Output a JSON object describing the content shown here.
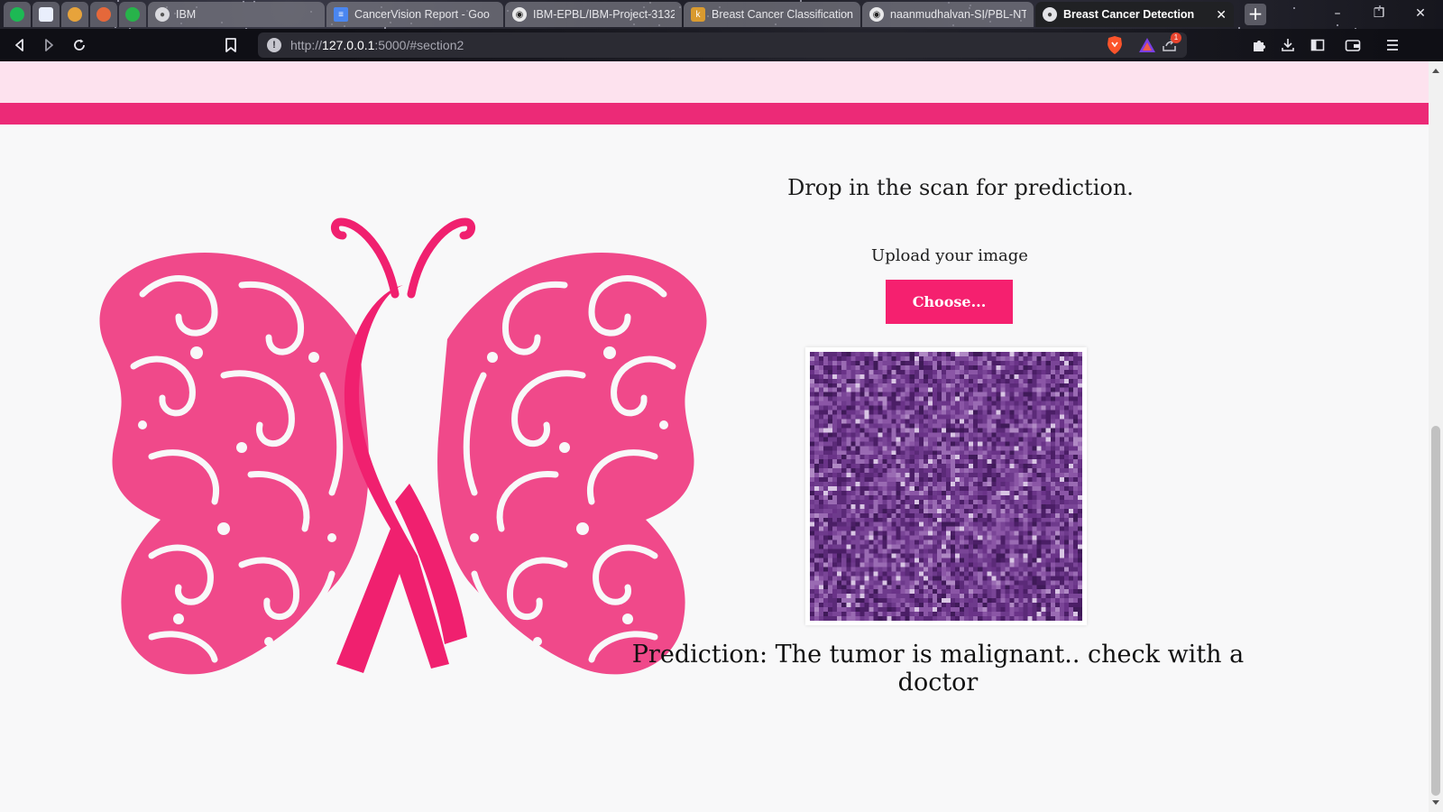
{
  "browser": {
    "tabs": [
      {
        "label": "IBM",
        "favicon": "globe-icon"
      },
      {
        "label": "CancerVision Report - Goo",
        "favicon": "docs-icon"
      },
      {
        "label": "IBM-EPBL/IBM-Project-3132",
        "favicon": "github-icon"
      },
      {
        "label": "Breast Cancer Classification",
        "favicon": "kaggle-icon"
      },
      {
        "label": "naanmudhalvan-SI/PBL-NT",
        "favicon": "github-icon"
      },
      {
        "label": "Breast Cancer Detection",
        "favicon": "globe-icon",
        "active": true
      }
    ],
    "close_glyph": "✕",
    "new_tab_glyph": "+",
    "url_scheme": "http://",
    "url_host": "127.0.0.1",
    "url_rest": ":5000/#section2",
    "notification_count": "1",
    "window_controls": [
      "–",
      "❐",
      "✕"
    ]
  },
  "colors": {
    "accent": "#ec2a77",
    "button": "#f5206f",
    "strip": "#fde2ee",
    "butterfly": "#f0498a"
  },
  "main": {
    "heading": "Drop in the scan for prediction.",
    "upload_label": "Upload your image",
    "choose_button": "Choose...",
    "prediction": "Prediction: The tumor is malignant.. check with a doctor"
  }
}
